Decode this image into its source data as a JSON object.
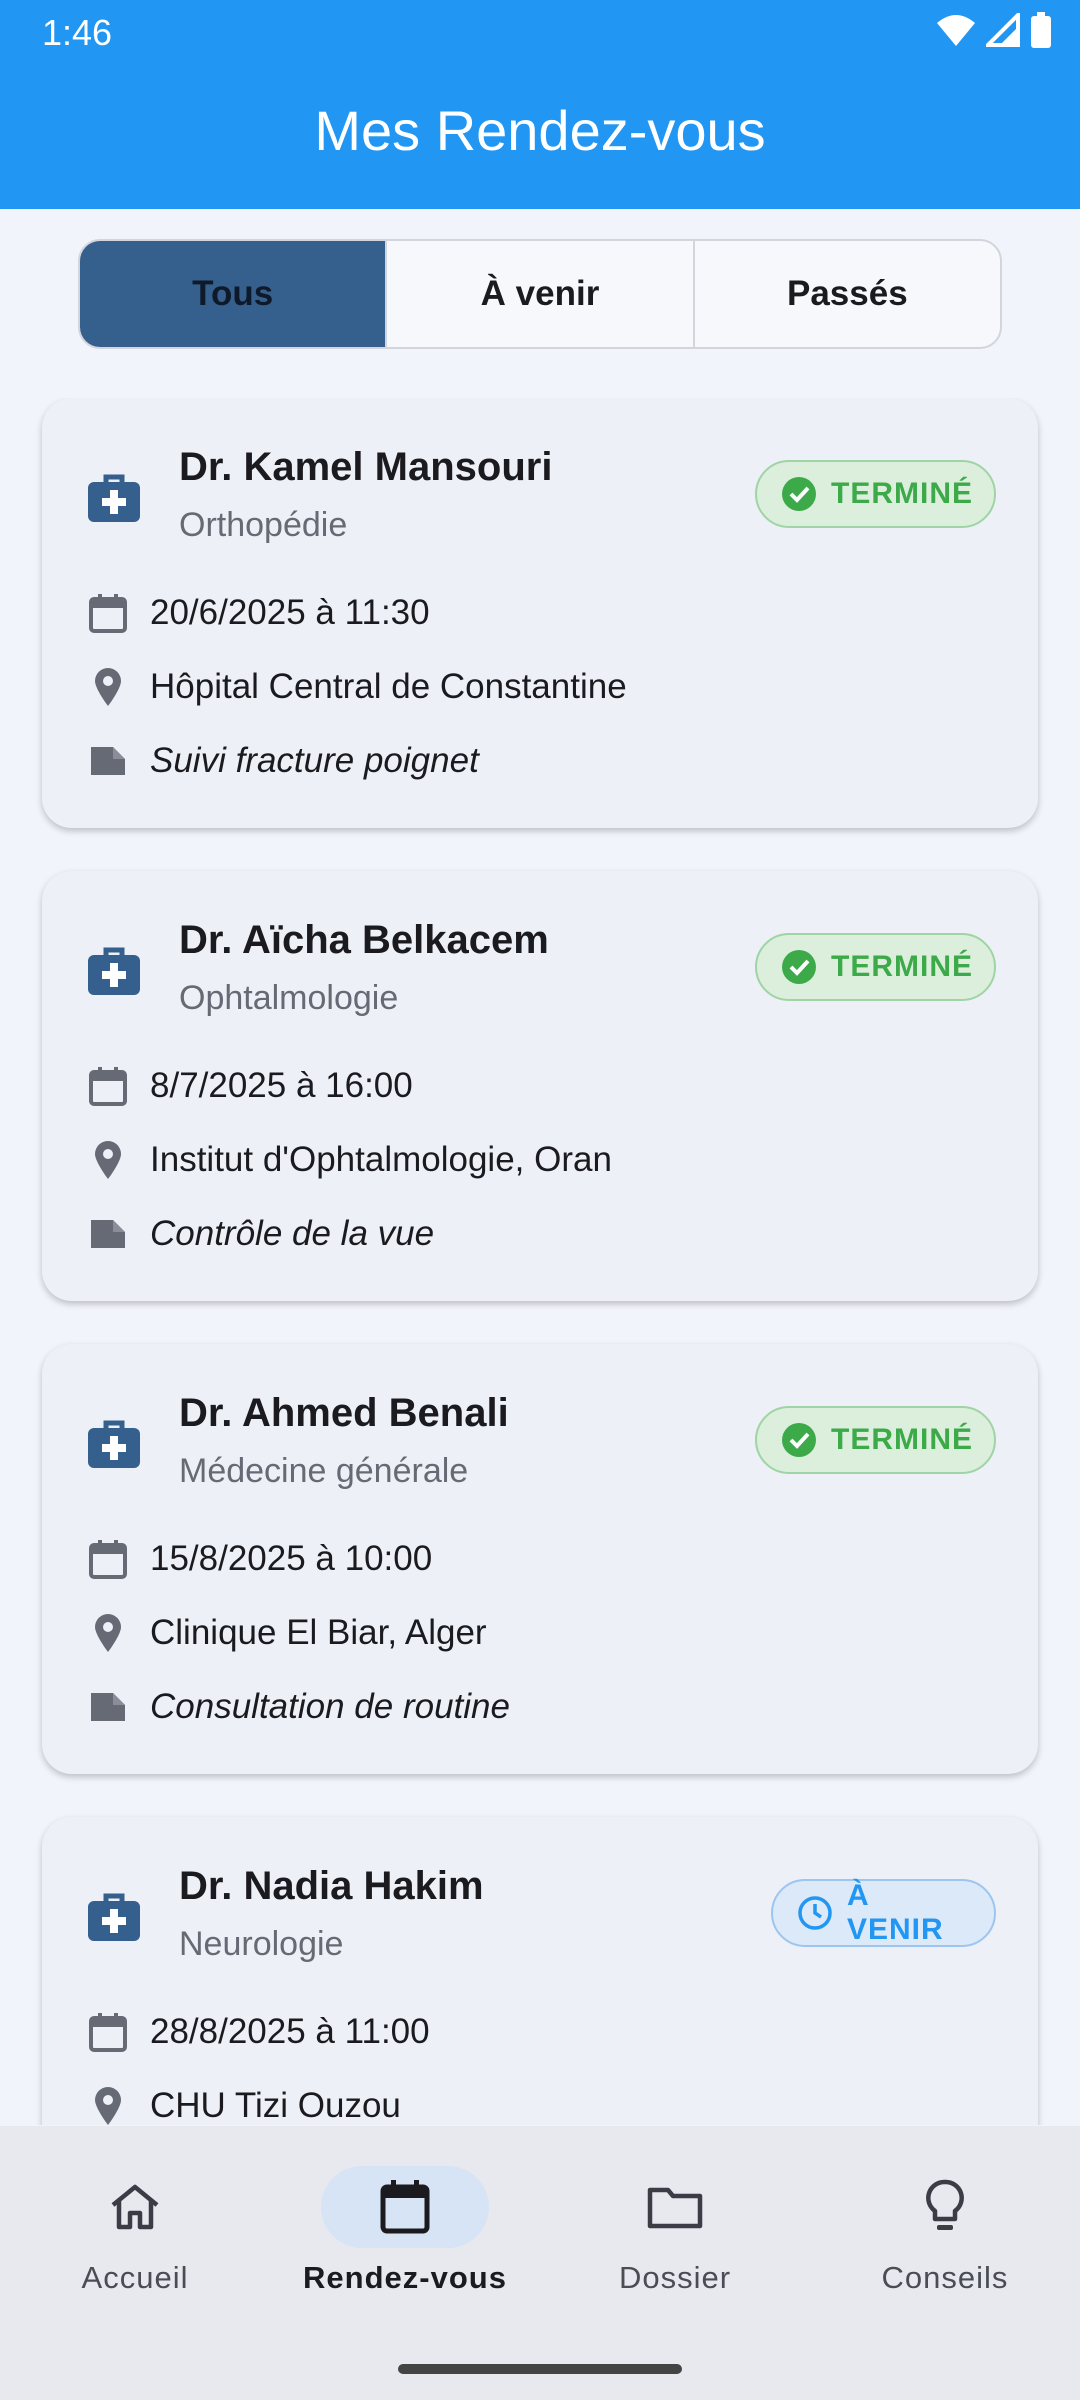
{
  "status_bar": {
    "time": "1:46"
  },
  "app_bar": {
    "title": "Mes Rendez-vous"
  },
  "filter_tabs": [
    {
      "label": "Tous",
      "selected": true
    },
    {
      "label": "À venir",
      "selected": false
    },
    {
      "label": "Passés",
      "selected": false
    }
  ],
  "appointments": [
    {
      "doctor": "Dr. Kamel Mansouri",
      "specialty": "Orthopédie",
      "status": "TERMINÉ",
      "status_kind": "done",
      "datetime": "20/6/2025 à 11:30",
      "location": "Hôpital Central de Constantine",
      "note": "Suivi fracture poignet"
    },
    {
      "doctor": "Dr. Aïcha Belkacem",
      "specialty": "Ophtalmologie",
      "status": "TERMINÉ",
      "status_kind": "done",
      "datetime": "8/7/2025 à 16:00",
      "location": "Institut d'Ophtalmologie, Oran",
      "note": "Contrôle de la vue"
    },
    {
      "doctor": "Dr. Ahmed Benali",
      "specialty": "Médecine générale",
      "status": "TERMINÉ",
      "status_kind": "done",
      "datetime": "15/8/2025 à 10:00",
      "location": "Clinique El Biar, Alger",
      "note": "Consultation de routine"
    },
    {
      "doctor": "Dr. Nadia Hakim",
      "specialty": "Neurologie",
      "status": "À VENIR",
      "status_kind": "upcoming",
      "datetime": "28/8/2025 à 11:00",
      "location": "CHU Tizi Ouzou",
      "note": ""
    }
  ],
  "bottom_nav": [
    {
      "label": "Accueil",
      "icon": "home-icon",
      "active": false
    },
    {
      "label": "Rendez-vous",
      "icon": "calendar-icon",
      "active": true
    },
    {
      "label": "Dossier",
      "icon": "folder-icon",
      "active": false
    },
    {
      "label": "Conseils",
      "icon": "lightbulb-icon",
      "active": false
    }
  ],
  "colors": {
    "primary": "#2196f3",
    "selected_tab": "#355f8c",
    "done": "#3daa4a",
    "upcoming": "#2196f3",
    "icon": "#355f8c"
  }
}
